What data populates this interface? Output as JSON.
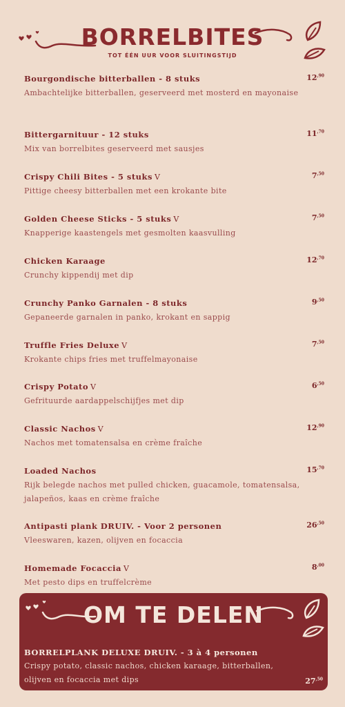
{
  "header": {
    "title": "BORRELBITES",
    "subtitle": "TOT ÉÉN UUR VOOR SLUITINGSTIJD"
  },
  "items": [
    {
      "name": "Bourgondische bitterballen - 8 stuks",
      "veg": "",
      "desc": "Ambachtelijke bitterballen, geserveerd met mosterd en mayonaise",
      "price_main": "12",
      "price_cents": ",90"
    },
    {
      "name": "Bittergarnituur - 12 stuks",
      "veg": "",
      "desc": "Mix van borrelbites geserveerd met sausjes",
      "price_main": "11",
      "price_cents": ",70"
    },
    {
      "name": "Crispy Chili Bites - 5 stuks",
      "veg": "V",
      "desc": "Pittige cheesy bitterballen met een krokante bite",
      "price_main": "7",
      "price_cents": ",50"
    },
    {
      "name": "Golden Cheese Sticks - 5 stuks",
      "veg": "V",
      "desc": "Knapperige kaastengels met gesmolten kaasvulling",
      "price_main": "7",
      "price_cents": ",50"
    },
    {
      "name": "Chicken Karaage",
      "veg": "",
      "desc": "Crunchy kippendij met dip",
      "price_main": "12",
      "price_cents": ",70"
    },
    {
      "name": "Crunchy Panko Garnalen - 8 stuks",
      "veg": "",
      "desc": "Gepaneerde garnalen in panko, krokant en sappig",
      "price_main": "9",
      "price_cents": ",50"
    },
    {
      "name": "Truffle Fries Deluxe",
      "veg": "V",
      "desc": "Krokante chips fries met truffelmayonaise",
      "price_main": "7",
      "price_cents": ",50"
    },
    {
      "name": "Crispy Potato",
      "veg": "V",
      "desc": "Gefrituurde aardappelschijfjes met dip",
      "price_main": "6",
      "price_cents": ",50"
    },
    {
      "name": "Classic Nachos",
      "veg": "V",
      "desc": "Nachos met tomatensalsa en crème fraîche",
      "price_main": "12",
      "price_cents": ",90"
    },
    {
      "name": "Loaded Nachos",
      "veg": "",
      "desc": "Rijk belegde nachos met pulled chicken, guacamole, tomatensalsa, jalapeños, kaas en crème fraîche",
      "price_main": "15",
      "price_cents": ",70"
    },
    {
      "name": "Antipasti plank DRUIV. - Voor 2 personen",
      "veg": "",
      "desc": "Vleeswaren, kazen, olijven en focaccia",
      "price_main": "26",
      "price_cents": ",50"
    },
    {
      "name": "Homemade Focaccia",
      "veg": "V",
      "desc": "Met pesto dips en truffelcrème",
      "price_main": "8",
      "price_cents": ",00"
    }
  ],
  "share": {
    "title": "OM TE DELEN",
    "item": {
      "name": "BORRELPLANK DELUXE DRUIV. - 3 à 4 personen",
      "desc": "Crispy potato, classic nachos, chicken karaage, bitterballen, olijven en focaccia met dips",
      "price_main": "27",
      "price_cents": ",50"
    }
  },
  "colors": {
    "background": "#efdccd",
    "accent": "#8a2a2e",
    "share_box": "#842a2e"
  },
  "icons": [
    "heart-icon",
    "leaf-icon",
    "swirl-line",
    "vegetarian-v-icon"
  ]
}
